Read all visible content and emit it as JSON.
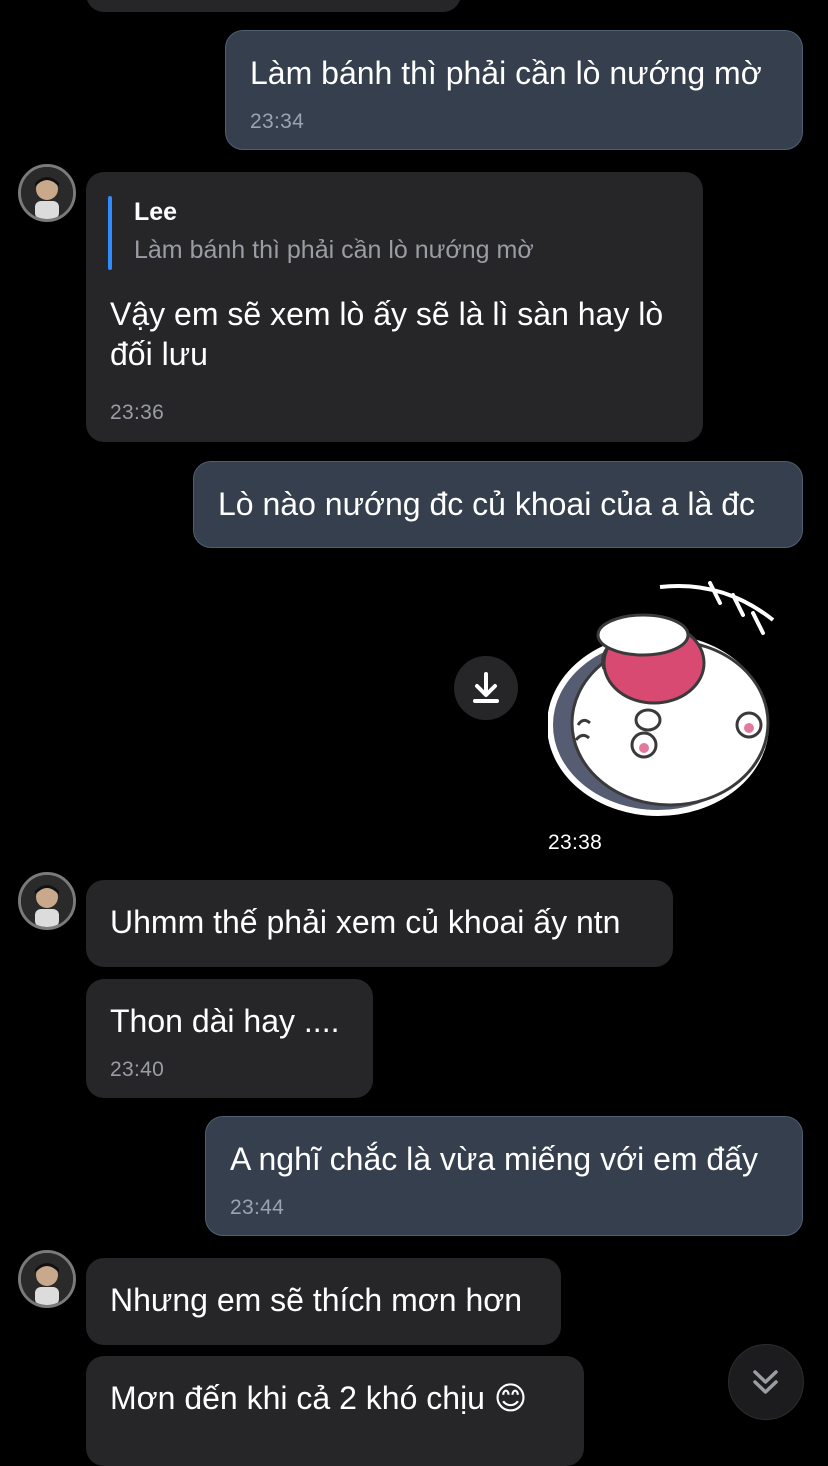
{
  "messages": {
    "m1": {
      "text": "Làm bánh thì phải cần lò nướng mờ",
      "time": "23:34"
    },
    "m2": {
      "reply_name": "Lee",
      "reply_text": "Làm bánh thì phải cần lò nướng mờ",
      "line1": "Vậy em sẽ xem lò ấy sẽ là lì sàn hay lò",
      "line2": "đối lưu",
      "time": "23:36"
    },
    "m3": {
      "text": "Lò nào nướng đc củ khoai của a là đc"
    },
    "sticker": {
      "time": "23:38",
      "icon": "cat-sticker"
    },
    "m4": {
      "text": "Uhmm thế phải xem củ khoai ấy ntn"
    },
    "m5": {
      "text": "Thon dài hay ....",
      "time": "23:40"
    },
    "m6": {
      "text": "A nghĩ chắc là vừa miếng với em đấy",
      "time": "23:44"
    },
    "m7": {
      "text": "Nhưng em sẽ thích mơn hơn"
    },
    "m8": {
      "text": "Mơn đến khi cả 2 khó chịu",
      "emoji": "😊"
    }
  },
  "icons": {
    "download": "download-icon",
    "scroll_down": "chevron-double-down-icon",
    "avatar": "avatar"
  },
  "colors": {
    "background": "#000000",
    "incoming_bubble": "#262628",
    "outgoing_bubble": "#353f4d",
    "accent": "#2d8cff"
  }
}
